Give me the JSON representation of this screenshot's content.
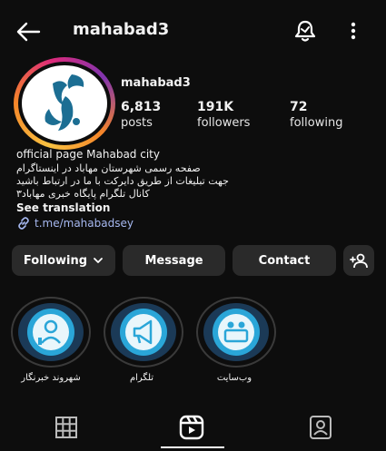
{
  "header": {
    "title": "mahabad3",
    "back_icon": "arrow-left-icon",
    "bell_icon": "bell-icon",
    "menu_icon": "more-vertical-icon"
  },
  "profile": {
    "name": "mahabad3",
    "stats": [
      {
        "value": "6,813",
        "label": "posts"
      },
      {
        "value": "191K",
        "label": "followers"
      },
      {
        "value": "72",
        "label": "following"
      }
    ]
  },
  "bio": {
    "headline": "official page Mahabad city",
    "lines": [
      "صفحه رسمی شهرستان مهاباد در اینستاگرام",
      "جهت تبلیغات از طریق دایرکت با ما در ارتباط باشید",
      "کانال تلگرام پایگاه خبری مهاباد۳"
    ],
    "see_translation": "See translation",
    "link": "t.me/mahabadsey"
  },
  "actions": {
    "following": "Following",
    "message": "Message",
    "contact": "Contact"
  },
  "highlights": [
    {
      "label": "شهروند خبرنگار",
      "icon": "reporter-icon"
    },
    {
      "label": "تلگرام",
      "icon": "megaphone-icon"
    },
    {
      "label": "وب‌سایت",
      "icon": "news-desk-icon"
    }
  ],
  "tabs": [
    "grid-icon",
    "reels-icon",
    "tagged-icon"
  ],
  "colors": {
    "background": "#0d0d0d",
    "button": "#2a2a2a",
    "link": "#a6b8f0",
    "highlight_bg": "#1b3a57"
  }
}
